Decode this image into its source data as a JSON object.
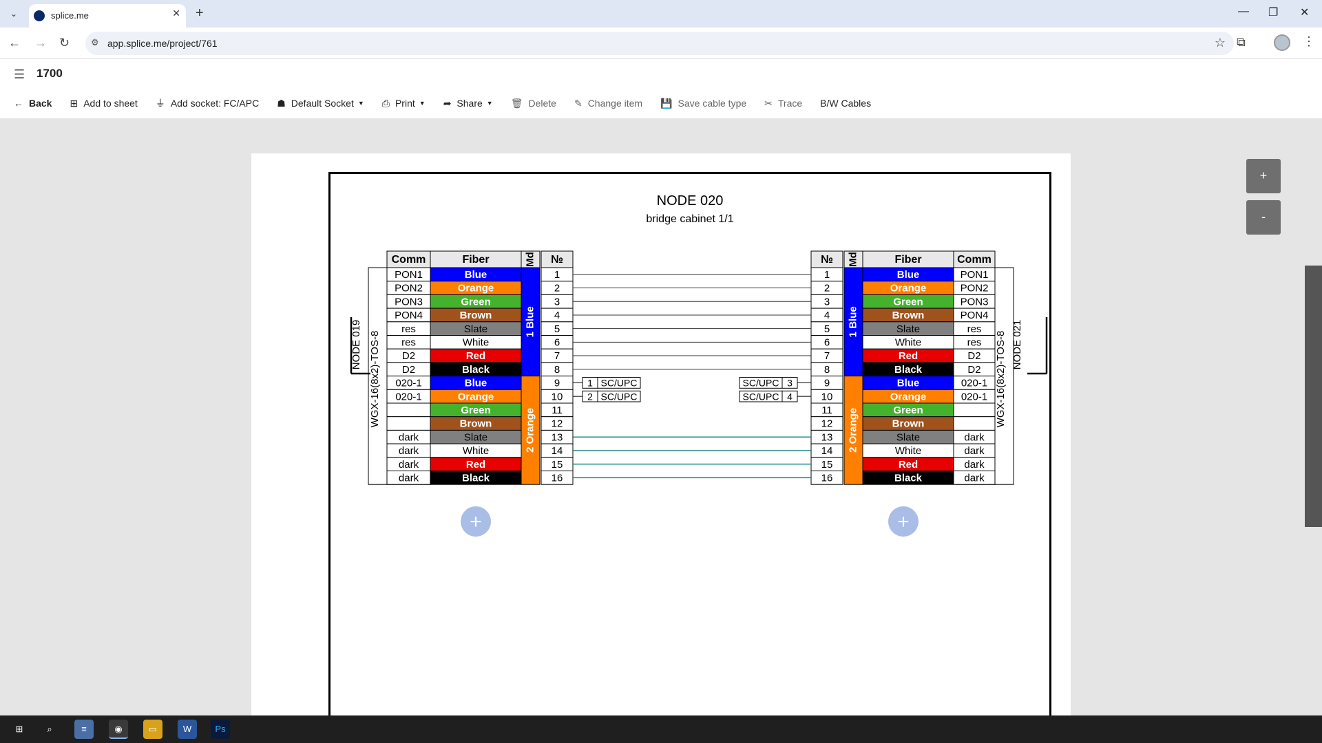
{
  "browser": {
    "tab_title": "splice.me",
    "url": "app.splice.me/project/761",
    "tab_list_icon": "chevron-down-icon",
    "new_tab_icon": "plus-icon"
  },
  "header": {
    "project_name": "1700"
  },
  "toolbar": {
    "back": "Back",
    "add_to_sheet": "Add to sheet",
    "add_socket": "Add socket: FC/APC",
    "default_socket": "Default Socket",
    "print": "Print",
    "share": "Share",
    "delete": "Delete",
    "change_item": "Change item",
    "save_cable_type": "Save cable type",
    "trace": "Trace",
    "bw_cables": "B/W Cables"
  },
  "diagram": {
    "title": "NODE 020",
    "subtitle": "bridge cabinet 1/1",
    "headers": {
      "comm": "Comm",
      "fiber": "Fiber",
      "md": "Md",
      "no": "№"
    },
    "left": {
      "node": "NODE 019",
      "cable": "WGX-16(8x2)-TOS-8",
      "modules": [
        "1 Blue",
        "2 Orange"
      ],
      "comm": [
        "PON1",
        "PON2",
        "PON3",
        "PON4",
        "res",
        "res",
        "D2",
        "D2",
        "020-1",
        "020-1",
        "",
        "",
        "dark",
        "dark",
        "dark",
        "dark"
      ]
    },
    "right": {
      "node": "NODE 021",
      "cable": "WGX-16(8x2)-TOS-8",
      "modules": [
        "1 Blue",
        "2 Orange"
      ],
      "comm": [
        "PON1",
        "PON2",
        "PON3",
        "PON4",
        "res",
        "res",
        "D2",
        "D2",
        "020-1",
        "020-1",
        "",
        "",
        "dark",
        "dark",
        "dark",
        "dark"
      ]
    },
    "fibers": [
      "Blue",
      "Orange",
      "Green",
      "Brown",
      "Slate",
      "White",
      "Red",
      "Black",
      "Blue",
      "Orange",
      "Green",
      "Brown",
      "Slate",
      "White",
      "Red",
      "Black"
    ],
    "fiber_colors": {
      "Blue": "#0000ff",
      "Orange": "#ff8000",
      "Green": "#44b22d",
      "Brown": "#a0521d",
      "Slate": "#808080",
      "White": "#ffffff",
      "Red": "#e60000",
      "Black": "#000000"
    },
    "module_colors": {
      "1 Blue": "#0000ff",
      "2 Orange": "#ff8000"
    },
    "numbers": [
      "1",
      "2",
      "3",
      "4",
      "5",
      "6",
      "7",
      "8",
      "9",
      "10",
      "11",
      "12",
      "13",
      "14",
      "15",
      "16"
    ],
    "left_sockets": [
      {
        "num": "1",
        "type": "SC/UPC"
      },
      {
        "num": "2",
        "type": "SC/UPC"
      }
    ],
    "right_sockets": [
      {
        "num": "3",
        "type": "SC/UPC"
      },
      {
        "num": "4",
        "type": "SC/UPC"
      }
    ],
    "splice_colors": {
      "plain": "#333333",
      "dark": "#1a8a8a"
    }
  },
  "zoom": {
    "in": "+",
    "out": "-"
  }
}
